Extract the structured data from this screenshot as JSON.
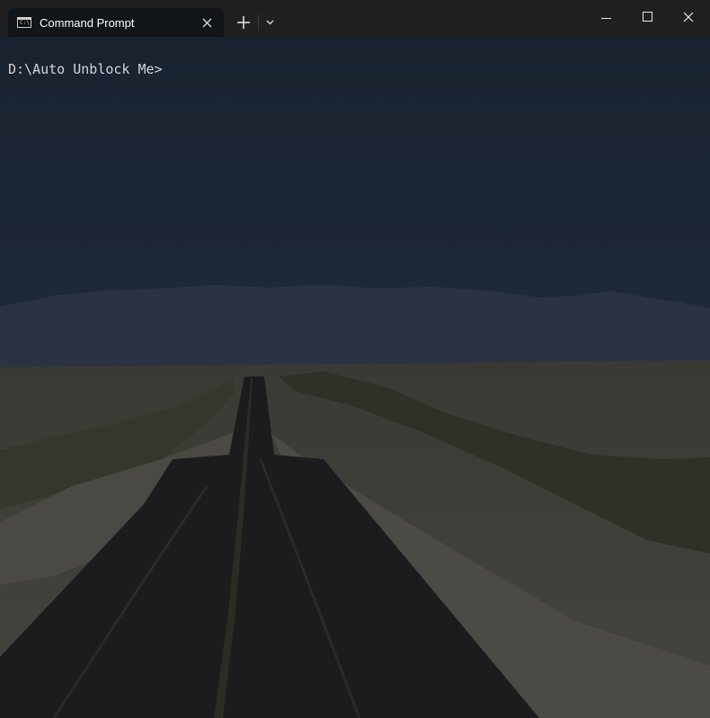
{
  "window": {
    "tab_title": "Command Prompt",
    "tab_icon": "command-prompt-icon",
    "icons": {
      "close_tab": "close-icon",
      "new_tab": "plus-icon",
      "dropdown": "chevron-down-icon",
      "minimize": "minimize-icon",
      "maximize": "maximize-icon",
      "close_window": "close-icon"
    }
  },
  "terminal": {
    "prompt": "D:\\Auto Unblock Me>",
    "background_image": "desert-road-at-dusk"
  },
  "colors": {
    "titlebar": "#202020",
    "tab_active": "#111418",
    "text": "#d4d4d4"
  }
}
